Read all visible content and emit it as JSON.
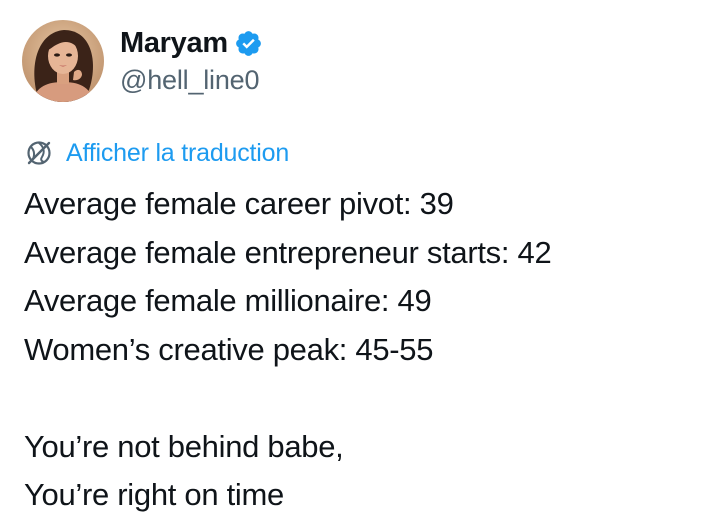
{
  "author": {
    "display_name": "Maryam",
    "handle": "@hell_line0",
    "verified": true,
    "verified_color": "#1d9bf0",
    "avatar_icon": "profile-photo"
  },
  "translate": {
    "icon": "globe-translate-icon",
    "label": "Afficher la traduction",
    "color": "#1d9bf0"
  },
  "tweet": {
    "lines": [
      "Average female career pivot: 39",
      "Average female entrepreneur starts: 42",
      "Average female millionaire: 49",
      "Women’s creative peak: 45-55"
    ],
    "closing_lines": [
      "You’re not behind babe,",
      "You’re right on time"
    ]
  }
}
